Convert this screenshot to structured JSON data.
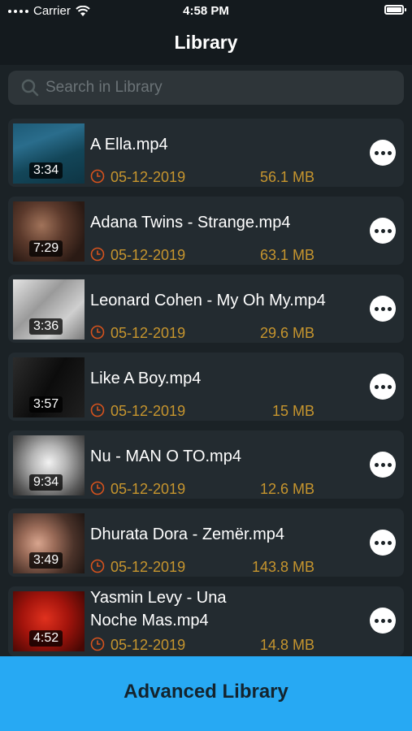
{
  "status_bar": {
    "carrier": "Carrier",
    "time": "4:58 PM"
  },
  "nav": {
    "title": "Library"
  },
  "search": {
    "placeholder": "Search in Library"
  },
  "items": [
    {
      "title": "A Ella.mp4",
      "duration": "3:34",
      "date": "05-12-2019",
      "size": "56.1 MB",
      "thumb": "ocean-blue"
    },
    {
      "title": "Adana Twins - Strange.mp4",
      "duration": "7:29",
      "date": "05-12-2019",
      "size": "63.1 MB",
      "thumb": "warm-dark"
    },
    {
      "title": "Leonard Cohen - My Oh My.mp4",
      "duration": "3:36",
      "date": "05-12-2019",
      "size": "29.6 MB",
      "thumb": "grey-light"
    },
    {
      "title": "Like A Boy.mp4",
      "duration": "3:57",
      "date": "05-12-2019",
      "size": "15 MB",
      "thumb": "black"
    },
    {
      "title": "Nu - MAN O TO.mp4",
      "duration": "9:34",
      "date": "05-12-2019",
      "size": "12.6 MB",
      "thumb": "monochrome"
    },
    {
      "title": "Dhurata Dora - Zemër.mp4",
      "duration": "3:49",
      "date": "05-12-2019",
      "size": "143.8 MB",
      "thumb": "portrait"
    },
    {
      "title_line1": "Yasmin Levy - Una",
      "title_line2": "Noche Mas.mp4",
      "duration": "4:52",
      "date": "05-12-2019",
      "size": "14.8 MB",
      "thumb": "red"
    }
  ],
  "bottom_button": {
    "label": "Advanced Library"
  },
  "colors": {
    "accent": "#c6952e",
    "bottom_button": "#27a9f3",
    "background": "#1b2226",
    "row": "#232b30"
  }
}
